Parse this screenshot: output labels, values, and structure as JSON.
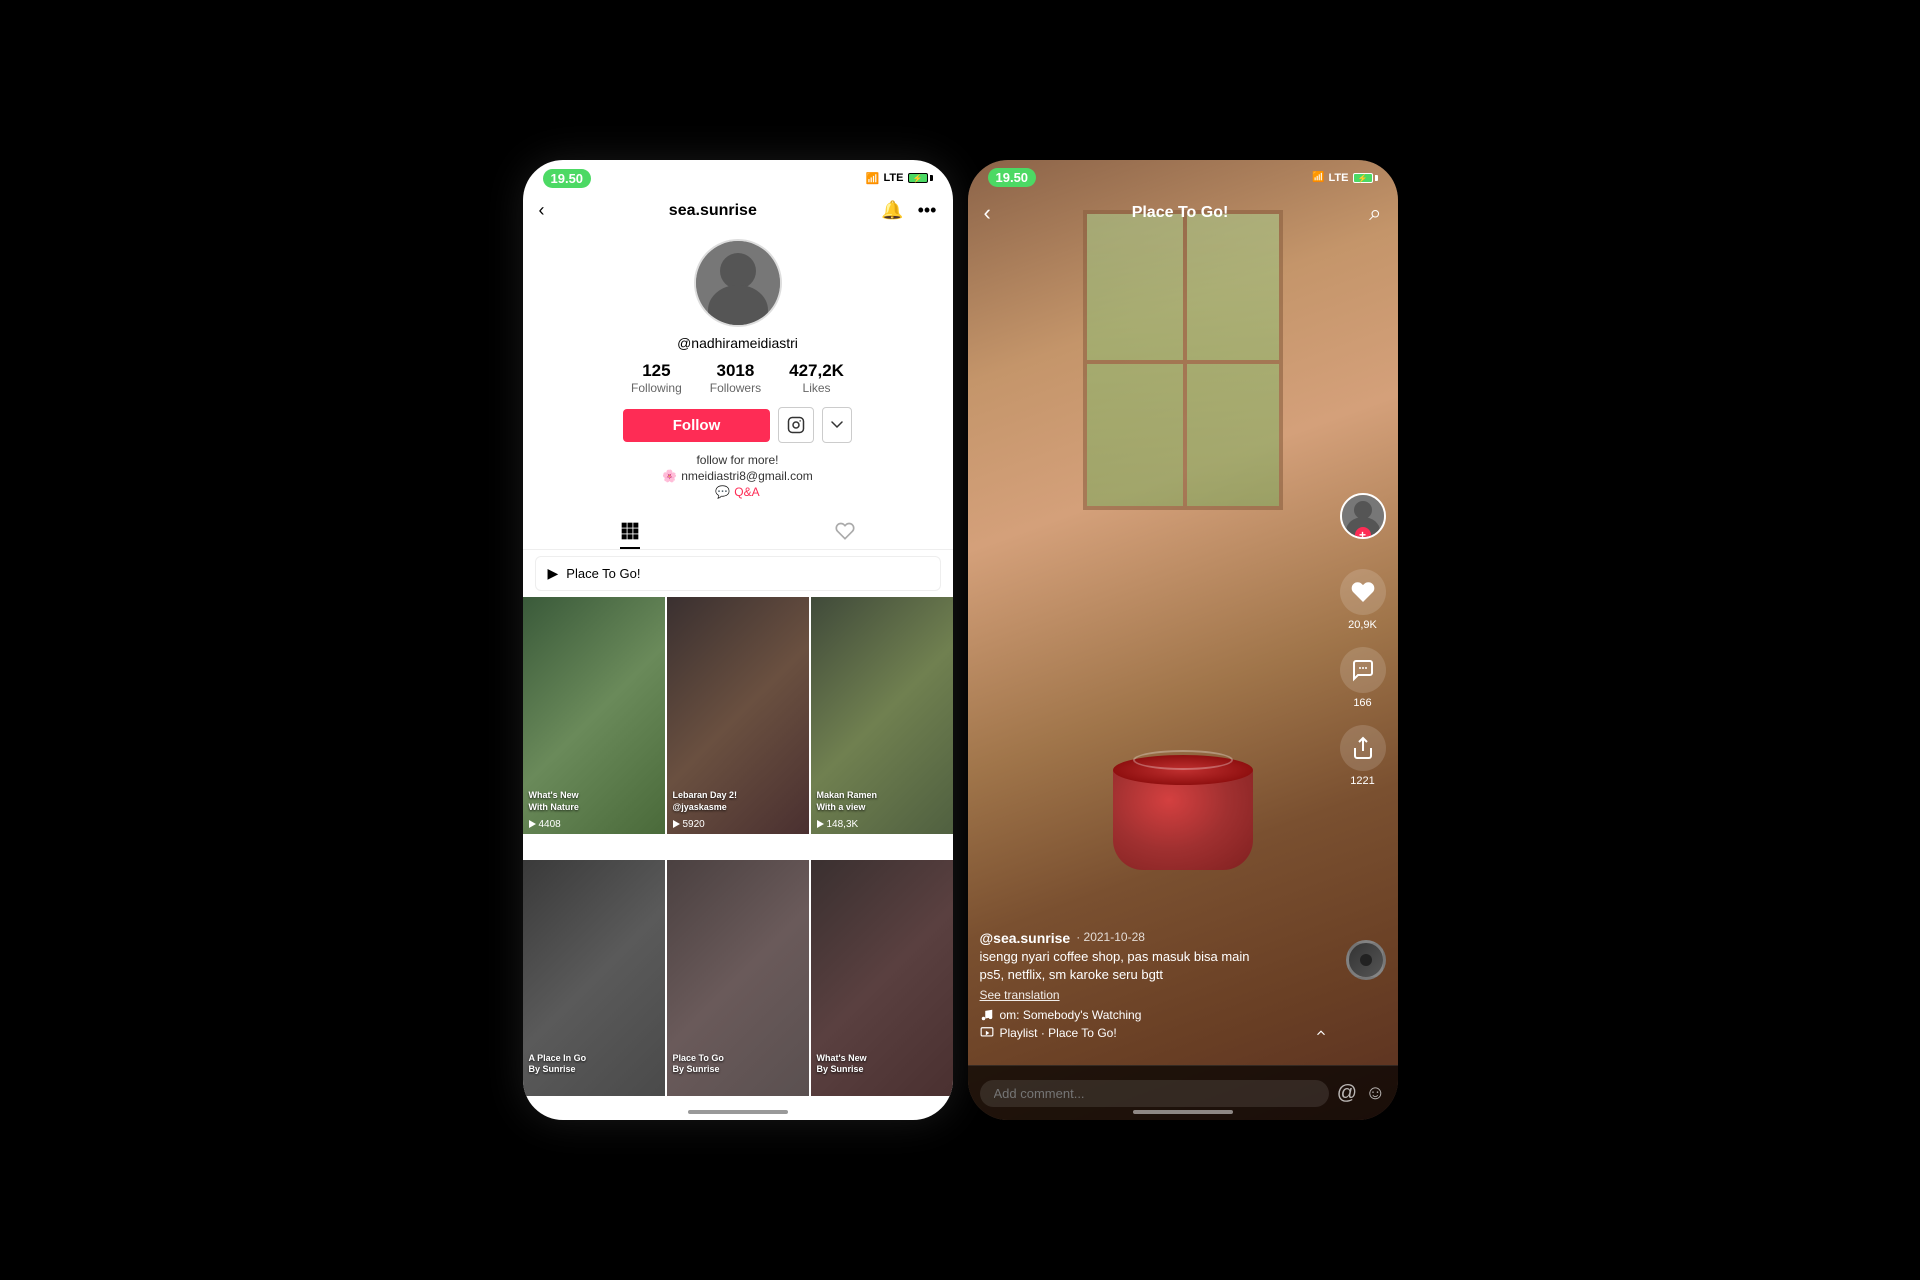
{
  "app": {
    "time": "19.50"
  },
  "left_screen": {
    "username_handle": "sea.sunrise",
    "profile_handle": "@nadhirameidiastri",
    "stats": {
      "following": {
        "value": "125",
        "label": "Following"
      },
      "followers": {
        "value": "3018",
        "label": "Followers"
      },
      "likes": {
        "value": "427,2K",
        "label": "Likes"
      }
    },
    "follow_button": "Follow",
    "bio": {
      "line1": "follow for more!",
      "email": "nmeidiastri8@gmail.com",
      "qa_label": "Q&A"
    },
    "playlist_banner": "Place To Go!",
    "tabs": {
      "videos_label": "videos",
      "liked_label": "liked"
    },
    "videos": [
      {
        "label": "What's New\nWith Nature",
        "views": "4408"
      },
      {
        "label": "Lebaran Day 2!\n@jyaskasme",
        "views": "5920"
      },
      {
        "label": "Makan Ramen\nWith a view",
        "views": "148,3K"
      },
      {
        "label": "A Place In Go\nBy Sunrise",
        "views": ""
      },
      {
        "label": "Place To Go\nBy Sunrise",
        "views": ""
      },
      {
        "label": "What's New\nBy Sunrise",
        "views": ""
      }
    ]
  },
  "right_screen": {
    "title": "Place To Go!",
    "creator": "@sea.sunrise",
    "date": "· 2021-10-28",
    "description": "isengg nyari coffee shop, pas masuk bisa main\nps5, netflix, sm karoke seru bgtt",
    "see_translation": "See translation",
    "music": "om: Somebody's Watching",
    "playlist": "Playlist · Place To Go!",
    "likes": "20,9K",
    "comments": "166",
    "shares": "1221",
    "comment_placeholder": "Add comment...",
    "nav": {
      "back": "‹",
      "title": "Place To Go!",
      "search": "⌕"
    }
  }
}
